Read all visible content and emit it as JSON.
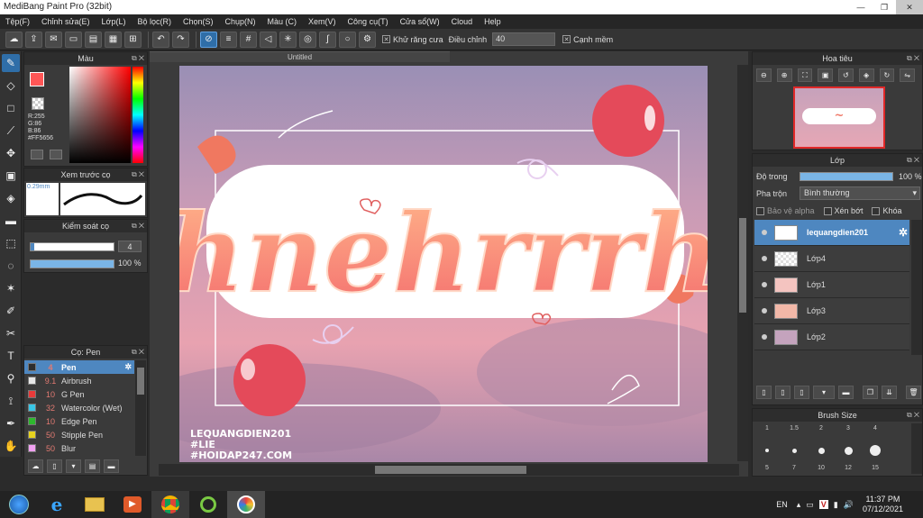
{
  "window": {
    "title": "MediBang Paint Pro (32bit)"
  },
  "menu": [
    "Tệp(F)",
    "Chỉnh sửa(E)",
    "Lớp(L)",
    "Bộ lọc(R)",
    "Chọn(S)",
    "Chụp(N)",
    "Màu (C)",
    "Xem(V)",
    "Công cụ(T)",
    "Cửa sổ(W)",
    "Cloud",
    "Help"
  ],
  "toolbar": {
    "antialias_label": "Khử răng cưa",
    "adjust_label": "Điều chỉnh",
    "adjust_value": "40",
    "smooth_label": "Cạnh mềm"
  },
  "color_panel": {
    "title": "Màu",
    "r": "R:255",
    "g": "G:86",
    "b": "B:86",
    "hex": "#FF5656",
    "primary": "#ff5656"
  },
  "brush_preview": {
    "title": "Xem trước cọ",
    "size": "0.29mm"
  },
  "brush_control": {
    "title": "Kiểm soát cọ",
    "size_value": "4",
    "opacity_value": "100 %"
  },
  "brush_panel": {
    "title": "Cọ: Pen",
    "brushes": [
      {
        "size": "4",
        "name": "Pen",
        "color": "#2d6fd1"
      },
      {
        "size": "9.1",
        "name": "Airbrush",
        "color": "#e6e6e6"
      },
      {
        "size": "10",
        "name": "G Pen",
        "color": "#e83a3a"
      },
      {
        "size": "32",
        "name": "Watercolor (Wet)",
        "color": "#39c6e6"
      },
      {
        "size": "10",
        "name": "Edge Pen",
        "color": "#2eb82e"
      },
      {
        "size": "50",
        "name": "Stipple Pen",
        "color": "#e6d21f"
      },
      {
        "size": "50",
        "name": "Blur",
        "color": "#f0a0f0"
      }
    ]
  },
  "canvas": {
    "tab_title": "Untitled",
    "main_word": "hnehrrrh",
    "signature": [
      "LEQUANGDIEN201",
      "#LIE",
      "#HOIDAP247.COM"
    ]
  },
  "navigator": {
    "title": "Hoa tiêu"
  },
  "layer_panel": {
    "title": "Lớp",
    "opacity_label": "Độ trong",
    "opacity_value": "100 %",
    "opacity_fraction": 1.0,
    "blend_label": "Pha trộn",
    "blend_value": "Bình thường",
    "protect_alpha": "Bảo vệ alpha",
    "clipping": "Xén bớt",
    "lock": "Khóa",
    "layers": [
      "lequangdien201",
      "Lớp4",
      "Lớp1",
      "Lớp3",
      "Lớp2"
    ]
  },
  "brush_size": {
    "title": "Brush Size",
    "row1": [
      "1",
      "1.5",
      "2",
      "3",
      "4"
    ],
    "row2": [
      "5",
      "7",
      "10",
      "12",
      "15"
    ]
  },
  "taskbar": {
    "lang": "EN",
    "time": "11:37 PM",
    "date": "07/12/2021"
  }
}
